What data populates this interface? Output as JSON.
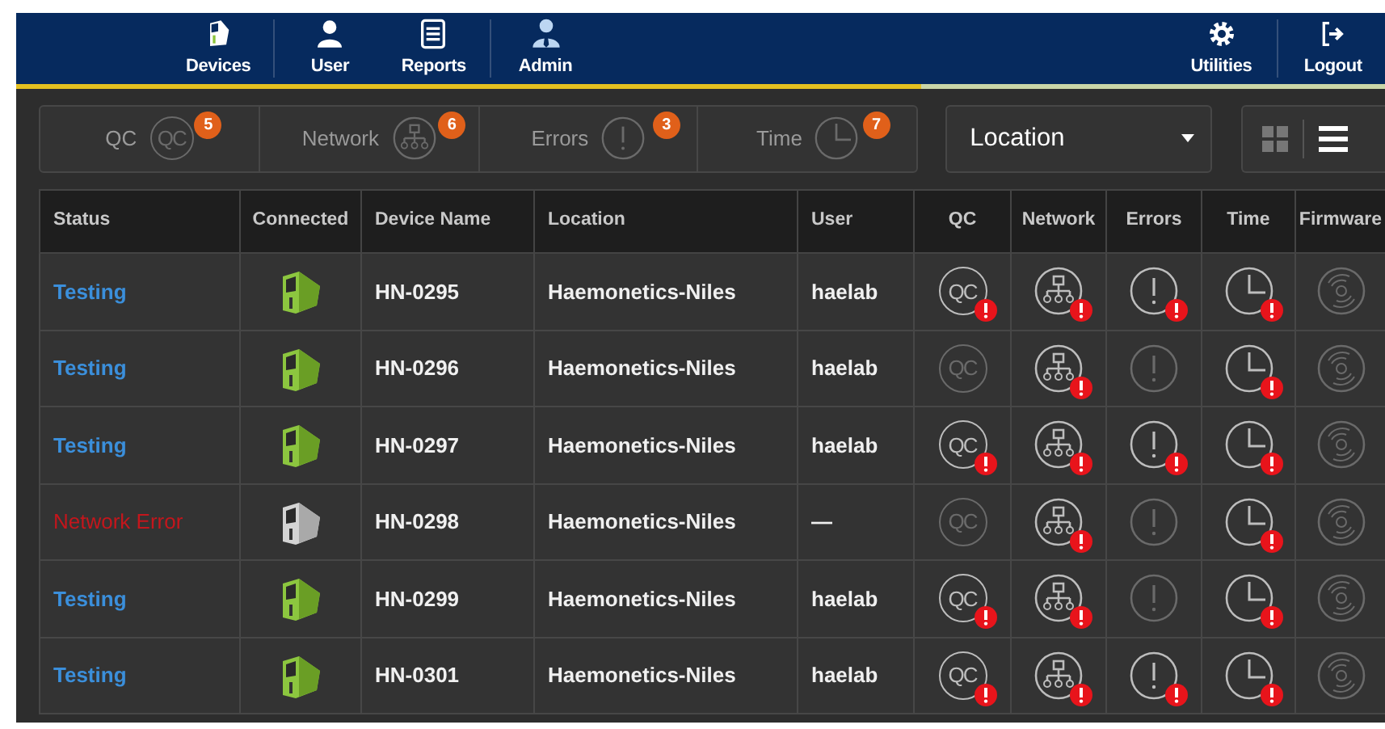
{
  "nav": {
    "left_groups": [
      [
        {
          "kind": "devices",
          "label": "Devices"
        }
      ],
      [
        {
          "kind": "user",
          "label": "User"
        },
        {
          "kind": "reports",
          "label": "Reports"
        }
      ],
      [
        {
          "kind": "admin",
          "label": "Admin"
        }
      ]
    ],
    "right_groups": [
      [
        {
          "kind": "utilities",
          "label": "Utilities"
        }
      ],
      [
        {
          "kind": "logout",
          "label": "Logout"
        }
      ]
    ]
  },
  "filters": [
    {
      "kind": "qc",
      "label": "QC",
      "icon_label": "QC",
      "count": "5"
    },
    {
      "kind": "network",
      "label": "Network",
      "count": "6"
    },
    {
      "kind": "errors",
      "label": "Errors",
      "count": "3"
    },
    {
      "kind": "time",
      "label": "Time",
      "count": "7"
    }
  ],
  "location_select": {
    "value": "Location"
  },
  "view_toggle": [
    {
      "kind": "grid",
      "selected": false
    },
    {
      "kind": "list",
      "selected": true
    }
  ],
  "table": {
    "columns": [
      "Status",
      "Connected",
      "Device Name",
      "Location",
      "User",
      "QC",
      "Network",
      "Errors",
      "Time",
      "Firmware"
    ],
    "rows": [
      {
        "status": "Testing",
        "kind": "testing",
        "connected": true,
        "device": "HN-0295",
        "location": "Haemonetics-Niles",
        "user": "haelab",
        "indicators": [
          {
            "kind": "qc",
            "label": "QC",
            "alert": true
          },
          {
            "kind": "network",
            "alert": true
          },
          {
            "kind": "errors",
            "alert": true
          },
          {
            "kind": "time",
            "alert": true
          },
          {
            "kind": "firmware",
            "alert": false
          }
        ]
      },
      {
        "status": "Testing",
        "kind": "testing",
        "connected": true,
        "device": "HN-0296",
        "location": "Haemonetics-Niles",
        "user": "haelab",
        "indicators": [
          {
            "kind": "qc",
            "label": "QC",
            "alert": false
          },
          {
            "kind": "network",
            "alert": true
          },
          {
            "kind": "errors",
            "alert": false
          },
          {
            "kind": "time",
            "alert": true
          },
          {
            "kind": "firmware",
            "alert": false
          }
        ]
      },
      {
        "status": "Testing",
        "kind": "testing",
        "connected": true,
        "device": "HN-0297",
        "location": "Haemonetics-Niles",
        "user": "haelab",
        "indicators": [
          {
            "kind": "qc",
            "label": "QC",
            "alert": true
          },
          {
            "kind": "network",
            "alert": true
          },
          {
            "kind": "errors",
            "alert": true
          },
          {
            "kind": "time",
            "alert": true
          },
          {
            "kind": "firmware",
            "alert": false
          }
        ]
      },
      {
        "status": "Network Error",
        "kind": "error",
        "connected": false,
        "device": "HN-0298",
        "location": "Haemonetics-Niles",
        "user": "—",
        "indicators": [
          {
            "kind": "qc",
            "label": "QC",
            "alert": false
          },
          {
            "kind": "network",
            "alert": true
          },
          {
            "kind": "errors",
            "alert": false
          },
          {
            "kind": "time",
            "alert": true
          },
          {
            "kind": "firmware",
            "alert": false
          }
        ]
      },
      {
        "status": "Testing",
        "kind": "testing",
        "connected": true,
        "device": "HN-0299",
        "location": "Haemonetics-Niles",
        "user": "haelab",
        "indicators": [
          {
            "kind": "qc",
            "label": "QC",
            "alert": true
          },
          {
            "kind": "network",
            "alert": true
          },
          {
            "kind": "errors",
            "alert": false
          },
          {
            "kind": "time",
            "alert": true
          },
          {
            "kind": "firmware",
            "alert": false
          }
        ]
      },
      {
        "status": "Testing",
        "kind": "testing",
        "connected": true,
        "device": "HN-0301",
        "location": "Haemonetics-Niles",
        "user": "haelab",
        "indicators": [
          {
            "kind": "qc",
            "label": "QC",
            "alert": true
          },
          {
            "kind": "network",
            "alert": true
          },
          {
            "kind": "errors",
            "alert": true
          },
          {
            "kind": "time",
            "alert": true
          },
          {
            "kind": "firmware",
            "alert": false
          }
        ]
      }
    ]
  }
}
